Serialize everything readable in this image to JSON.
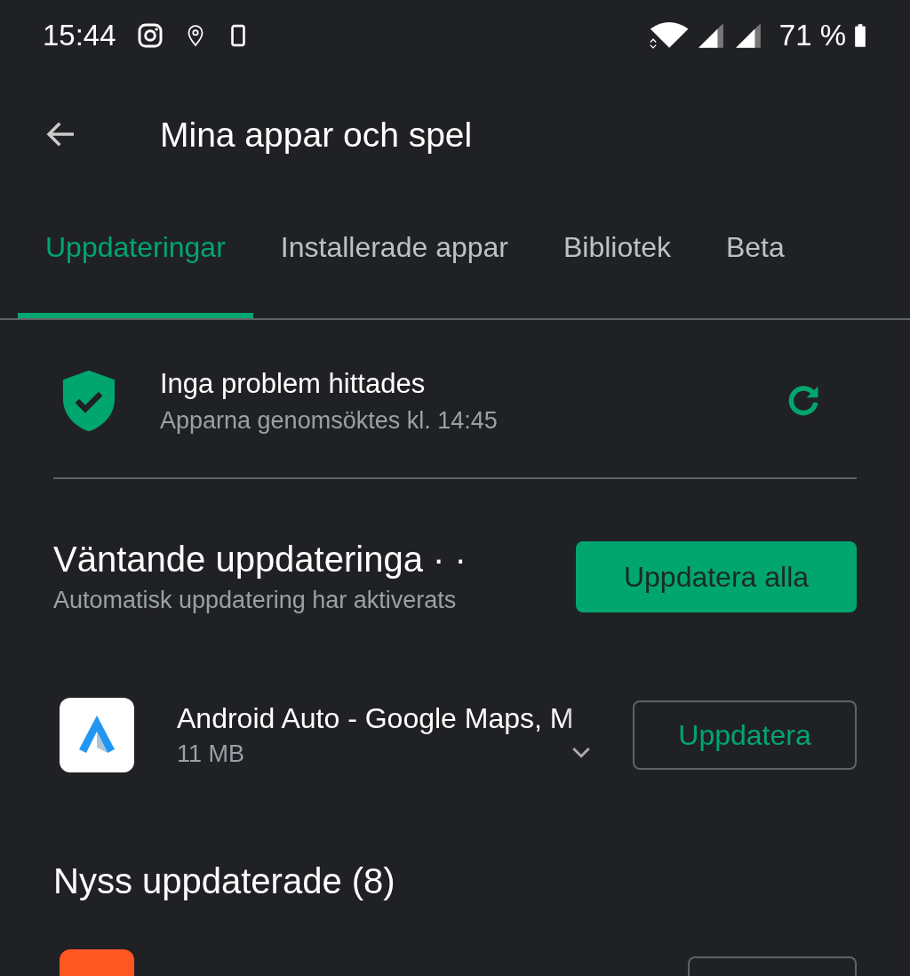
{
  "status_bar": {
    "time": "15:44",
    "battery": "71 %"
  },
  "toolbar": {
    "title": "Mina appar och spel"
  },
  "tabs": [
    {
      "label": "Uppdateringar",
      "selected": true
    },
    {
      "label": "Installerade appar",
      "selected": false
    },
    {
      "label": "Bibliotek",
      "selected": false
    },
    {
      "label": "Beta",
      "selected": false
    }
  ],
  "security": {
    "title": "Inga problem hittades",
    "subtitle": "Apparna genomsöktes kl. 14:45"
  },
  "pending": {
    "title": "Väntande uppdateringa · ·",
    "subtitle": "Automatisk uppdatering har aktiverats",
    "button": "Uppdatera alla"
  },
  "apps": [
    {
      "name": "Android Auto - Google Maps, M",
      "size": "11 MB",
      "button": "Uppdatera"
    }
  ],
  "recent": {
    "title": "Nyss uppdaterade (8)"
  }
}
